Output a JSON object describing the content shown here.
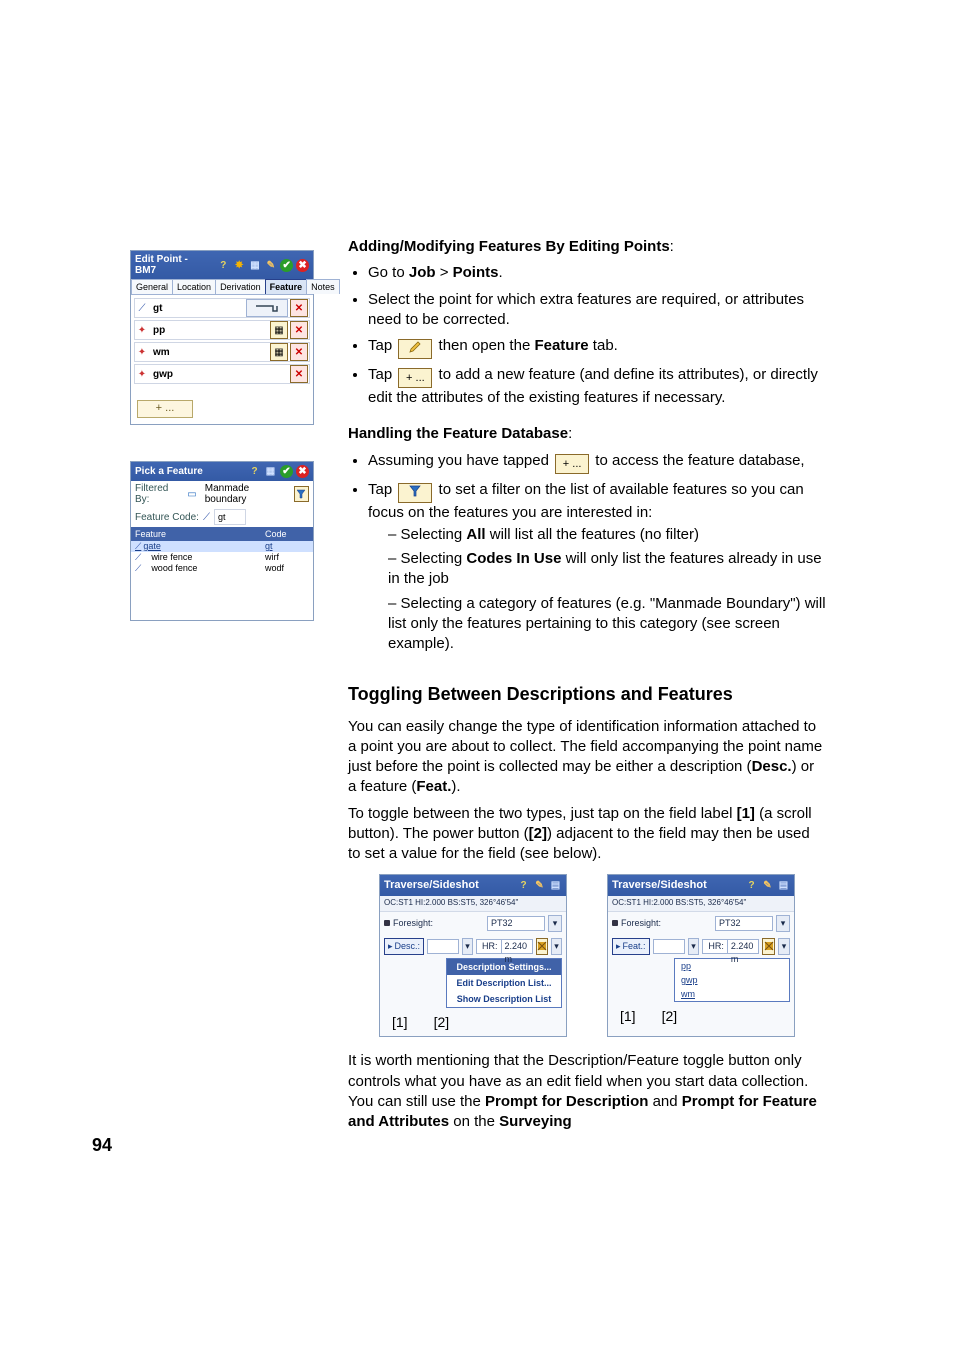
{
  "sections": {
    "add_heading": "Adding/Modifying Features By Editing Points",
    "handle_heading": "Handling the Feature Database",
    "toggle_heading": "Toggling Between Descriptions and Features"
  },
  "body": {
    "b1_pre": "Go to ",
    "b1_job": "Job",
    "b1_gt": " > ",
    "b1_points": "Points",
    "b1_post": ".",
    "b2": "Select the point for which extra features are required, or attributes need to be corrected.",
    "b3_pre": "Tap ",
    "b3_mid": " then open the ",
    "b3_feature": "Feature",
    "b3_post": " tab.",
    "b4_pre": "Tap ",
    "b4_post": " to add a new feature (and define its attributes), or directly edit the attributes of the existing features if necessary.",
    "h1_pre": "Assuming you have tapped ",
    "h1_post": " to access the feature database,",
    "h2_pre": "Tap ",
    "h2_post": " to set a filter on the list of available features so you can focus on the features you are interested in:",
    "h2_s1_pre": "Selecting ",
    "h2_s1_b": "All",
    "h2_s1_post": " will list all the features (no filter)",
    "h2_s2_pre": "Selecting ",
    "h2_s2_b": "Codes In Use",
    "h2_s2_post": " will only list the features already in use in the job",
    "h2_s3": "Selecting a category of features (e.g. \"Manmade Boundary\") will list only the features pertaining to this category (see screen example).",
    "t_p1_a": "You can easily change the type of identification information attached to a point you are about to collect. The field accompanying the point name just before the point is collected may be either a description (",
    "t_p1_b1": "Desc.",
    "t_p1_mid": ") or a feature (",
    "t_p1_b2": "Feat.",
    "t_p1_post": ").",
    "t_p2_a": "To toggle between the two types, just tap on the field label ",
    "t_p2_b1": "[1]",
    "t_p2_mid": " (a scroll button). The power button (",
    "t_p2_b2": "[2]",
    "t_p2_post": ") adjacent to the field may then be used to set a value for the field (see below).",
    "t_p3_a": "It is worth mentioning that the Description/Feature toggle button only controls what you have as an edit field when you start data collection. You can still use the ",
    "t_p3_b1": "Prompt for Description",
    "t_p3_mid": " and ",
    "t_p3_b2": "Prompt for Feature and Attributes",
    "t_p3_mid2": " on the ",
    "t_p3_b3": "Surveying"
  },
  "buttons": {
    "add_label": "+ ...",
    "pencil_alt": "pencil",
    "filter_alt": "filter"
  },
  "edit_point_win": {
    "title": "Edit Point - BM7",
    "tabs": [
      "General",
      "Location",
      "Derivation",
      "Feature",
      "Notes"
    ],
    "sel_tab_index": 3,
    "rows": [
      {
        "icon": "line",
        "name": "gt",
        "btns": [
          "clip",
          "x"
        ],
        "first_alt": true
      },
      {
        "icon": "pt",
        "name": "pp",
        "btns": [
          "grid",
          "x"
        ]
      },
      {
        "icon": "pt",
        "name": "wm",
        "btns": [
          "grid",
          "x"
        ]
      },
      {
        "icon": "pt",
        "name": "gwp",
        "btns": [
          "x"
        ]
      }
    ],
    "add_label": "+ ..."
  },
  "pick_win": {
    "title": "Pick a Feature",
    "filtered_by_label": "Filtered By:",
    "filtered_by_value": "Manmade boundary",
    "feature_code_label": "Feature Code:",
    "feature_code_value": "gt",
    "head_feature": "Feature",
    "head_code": "Code",
    "rows": [
      {
        "name": "gate",
        "code": "gt",
        "sel": true
      },
      {
        "name": "wire fence",
        "code": "wirf"
      },
      {
        "name": "wood fence",
        "code": "wodf"
      }
    ]
  },
  "ts_shared": {
    "title": "Traverse/Sideshot",
    "status": "OC:ST1  HI:2.000  BS:ST5, 326°46'54\"",
    "foresight_label": "Foresight:",
    "foresight_value": "PT32",
    "hr_label": "HR:",
    "hr_value": "2.240 m",
    "mark1": "[1]",
    "mark2": "[2]"
  },
  "ts_left": {
    "toggle_label": "Desc.:",
    "menu_header": "Description Settings...",
    "menu_items": [
      "Edit Description List...",
      "Show Description List"
    ]
  },
  "ts_right": {
    "toggle_label": "Feat.:",
    "list_items": [
      "pp",
      "gwp",
      "wm"
    ]
  },
  "page_number": "94"
}
